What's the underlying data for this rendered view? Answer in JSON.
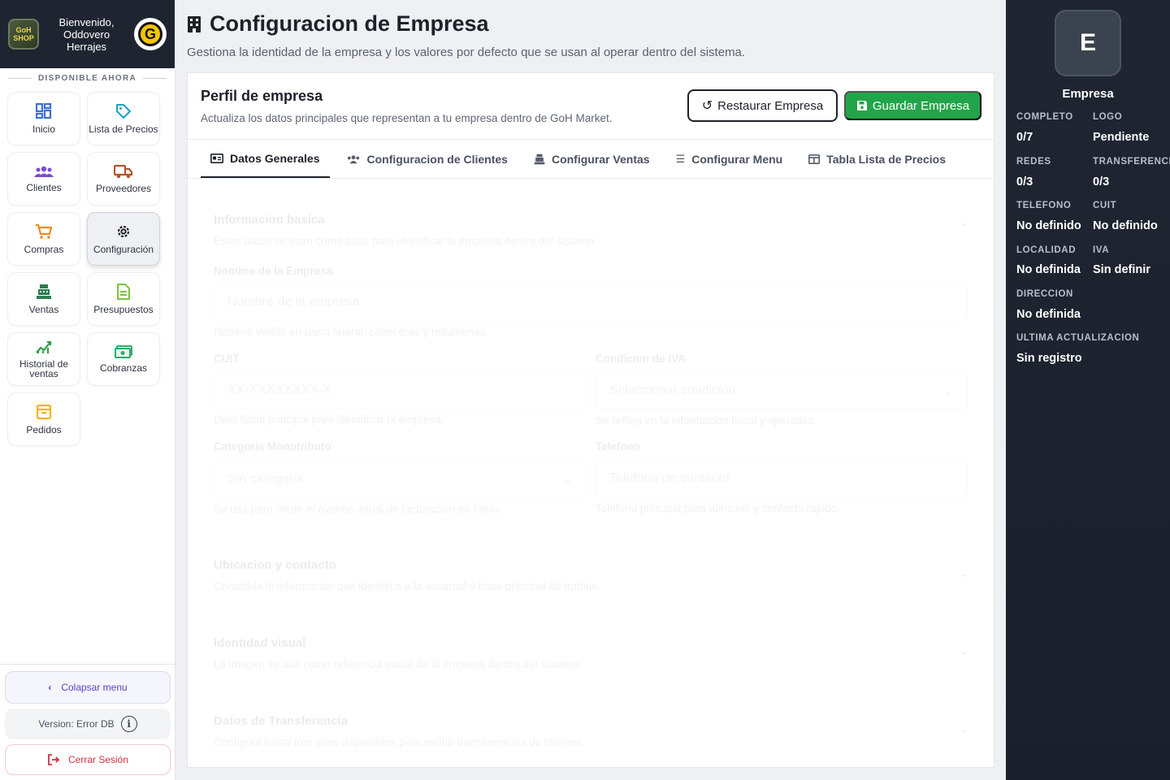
{
  "sidebar": {
    "welcome": "Bienvenido, Oddovero Herrajes",
    "brand_text": "GoH SHOP",
    "logo_letter": "G",
    "section_label": "DISPONIBLE AHORA",
    "items": [
      {
        "label": "Inicio",
        "icon": "dashboard-icon",
        "color": "#3b6fd6"
      },
      {
        "label": "Lista de Precios",
        "icon": "tag-icon",
        "color": "#19a3c4"
      },
      {
        "label": "Clientes",
        "icon": "users-icon",
        "color": "#7c4bd6"
      },
      {
        "label": "Proveedores",
        "icon": "truck-icon",
        "color": "#b5542a"
      },
      {
        "label": "Compras",
        "icon": "cart-icon",
        "color": "#f08a1c"
      },
      {
        "label": "Configuración",
        "icon": "gear-icon",
        "color": "#1d2129"
      },
      {
        "label": "Ventas",
        "icon": "cash-register-icon",
        "color": "#2e7d4f"
      },
      {
        "label": "Presupuestos",
        "icon": "document-icon",
        "color": "#7bc23c"
      },
      {
        "label": "Historial de ventas",
        "icon": "chart-line-icon",
        "color": "#2e9d4f"
      },
      {
        "label": "Cobranzas",
        "icon": "money-icon",
        "color": "#2faa6b"
      },
      {
        "label": "Pedidos",
        "icon": "box-icon",
        "color": "#f0b51c"
      }
    ],
    "collapse_label": "Colapsar menu",
    "version_label": "Version: Error DB",
    "logout_label": "Cerrar Sesión"
  },
  "header": {
    "title": "Configuracion de Empresa",
    "subtitle": "Gestiona la identidad de la empresa y los valores por defecto que se usan al operar dentro del sistema."
  },
  "card": {
    "title": "Perfil de empresa",
    "description": "Actualiza los datos principales que representan a tu empresa dentro de GoH Market.",
    "restore_label": "Restaurar Empresa",
    "save_label": "Guardar Empresa",
    "tabs": [
      {
        "label": "Datos Generales",
        "icon": "id-card-icon"
      },
      {
        "label": "Configuracion de Clientes",
        "icon": "users-icon"
      },
      {
        "label": "Configurar Ventas",
        "icon": "cash-register-icon"
      },
      {
        "label": "Configurar Menu",
        "icon": "menu-icon"
      },
      {
        "label": "Tabla Lista de Precios",
        "icon": "table-icon"
      }
    ]
  },
  "form": {
    "basic": {
      "title": "Informacion basica",
      "description": "Estos datos se usan como base para identificar la empresa dentro del sistema.",
      "name_label": "Nombre de la Empresa",
      "name_placeholder": "Nombre de la empresa",
      "name_help": "Nombre visible en barra lateral, cabeceras y resumenes.",
      "cuit_label": "CUIT",
      "cuit_placeholder": "XX-XXXXXXXX-X",
      "cuit_help": "Dato fiscal principal para identificar la empresa.",
      "iva_label": "Condicion de IVA",
      "iva_value": "Seleccionar condicion",
      "iva_help": "Se refleja en la informacion fiscal y operativa.",
      "mono_label": "Categoria Monotributo",
      "mono_value": "Sin categoria",
      "mono_help": "Se usa para medir el avance anual de facturacion en Inicio.",
      "phone_label": "Telefono",
      "phone_placeholder": "Telefono de contacto",
      "phone_help": "Telefono principal para atencion y contacto rapido."
    },
    "location": {
      "title": "Ubicacion y contacto",
      "description": "Consolida la informacion que identifica a la sucursal o base principal de trabajo."
    },
    "visual": {
      "title": "Identidad visual",
      "description": "La imagen se usa como referencia visual de la empresa dentro del sistema."
    },
    "transfer": {
      "title": "Datos de Transferencia",
      "description": "Configura hasta tres alias disponibles para recibir transferencias de clientes."
    }
  },
  "summary": {
    "avatar_letter": "E",
    "title": "Empresa",
    "stats": [
      {
        "label": "COMPLETO",
        "value": "0/7"
      },
      {
        "label": "LOGO",
        "value": "Pendiente"
      },
      {
        "label": "REDES",
        "value": "0/3"
      },
      {
        "label": "TRANSFERENCIAS",
        "value": "0/3"
      },
      {
        "label": "TELEFONO",
        "value": "No definido"
      },
      {
        "label": "CUIT",
        "value": "No definido"
      },
      {
        "label": "LOCALIDAD",
        "value": "No definida"
      },
      {
        "label": "IVA",
        "value": "Sin definir"
      },
      {
        "label": "DIRECCION",
        "value": "No definida"
      },
      {
        "label": "ULTIMA ACTUALIZACION",
        "value": "Sin registro"
      }
    ]
  },
  "colors": {
    "accent_green": "#22a54a",
    "sidebar_dark": "#1f2530",
    "collapse_purple": "#5b3fc8",
    "logout_red": "#d32f3f"
  }
}
